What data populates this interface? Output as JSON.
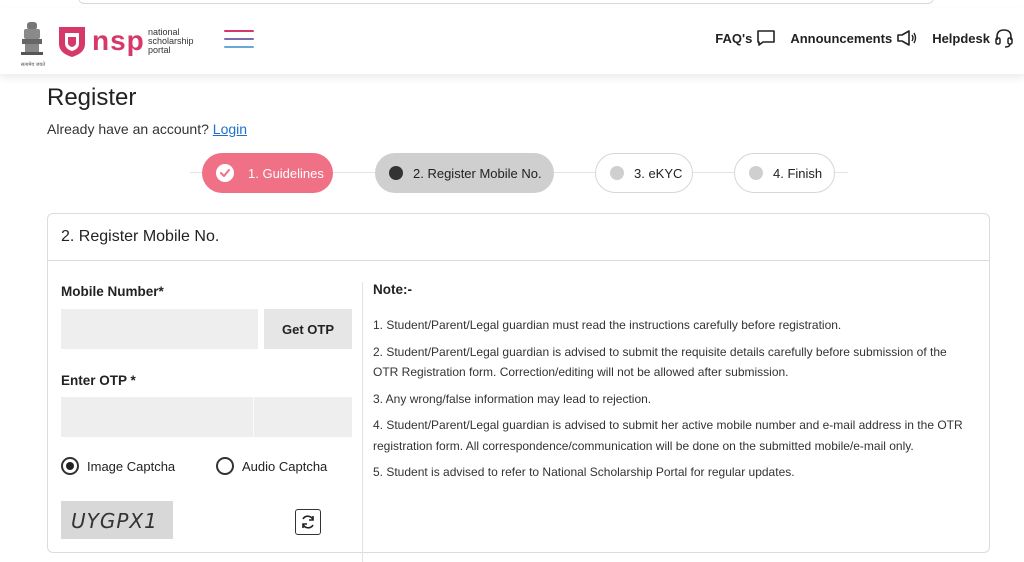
{
  "header": {
    "logo_text": "nsp",
    "logo_sub": [
      "national",
      "scholarship",
      "portal"
    ],
    "emblem_caption": "सत्यमेव जयते",
    "nav": [
      {
        "label": "FAQ's",
        "icon": "chat-icon"
      },
      {
        "label": "Announcements",
        "icon": "megaphone-icon"
      },
      {
        "label": "Helpdesk",
        "icon": "headset-icon"
      }
    ],
    "colors": {
      "brand": "#d6386a",
      "hamburger": [
        "#d6386a",
        "#7b6bb0",
        "#6aa7d8",
        "#2b7fbf"
      ]
    }
  },
  "page": {
    "title": "Register",
    "already_text": "Already have an account?",
    "login_link": "Login"
  },
  "stepper": {
    "steps": [
      {
        "label": "1. Guidelines",
        "state": "completed"
      },
      {
        "label": "2. Register Mobile No.",
        "state": "active"
      },
      {
        "label": "3. eKYC",
        "state": "pending"
      },
      {
        "label": "4. Finish",
        "state": "pending"
      }
    ],
    "colors": {
      "completed": "#f07086",
      "active": "#cfcfcf"
    }
  },
  "card": {
    "title": "2. Register Mobile No.",
    "form": {
      "mobile_label": "Mobile Number*",
      "mobile_value": "",
      "otp_button": "Get OTP",
      "otp_label": "Enter OTP *",
      "otp_value": "",
      "captcha_options": [
        {
          "label": "Image Captcha",
          "selected": true
        },
        {
          "label": "Audio Captcha",
          "selected": false
        }
      ],
      "captcha_text": "UYGPX1"
    },
    "notes": {
      "title": "Note:-",
      "items": [
        "1. Student/Parent/Legal guardian must read the instructions carefully before registration.",
        "2. Student/Parent/Legal guardian is advised to submit the requisite details carefully before submission of the OTR Registration form. Correction/editing will not be allowed after submission.",
        "3. Any wrong/false information may lead to rejection.",
        "4. Student/Parent/Legal guardian is advised to submit her active mobile number and e-mail address in the OTR registration form. All correspondence/communication will be done on the submitted mobile/e-mail only.",
        "5. Student is advised to refer to National Scholarship Portal for regular updates."
      ]
    }
  }
}
